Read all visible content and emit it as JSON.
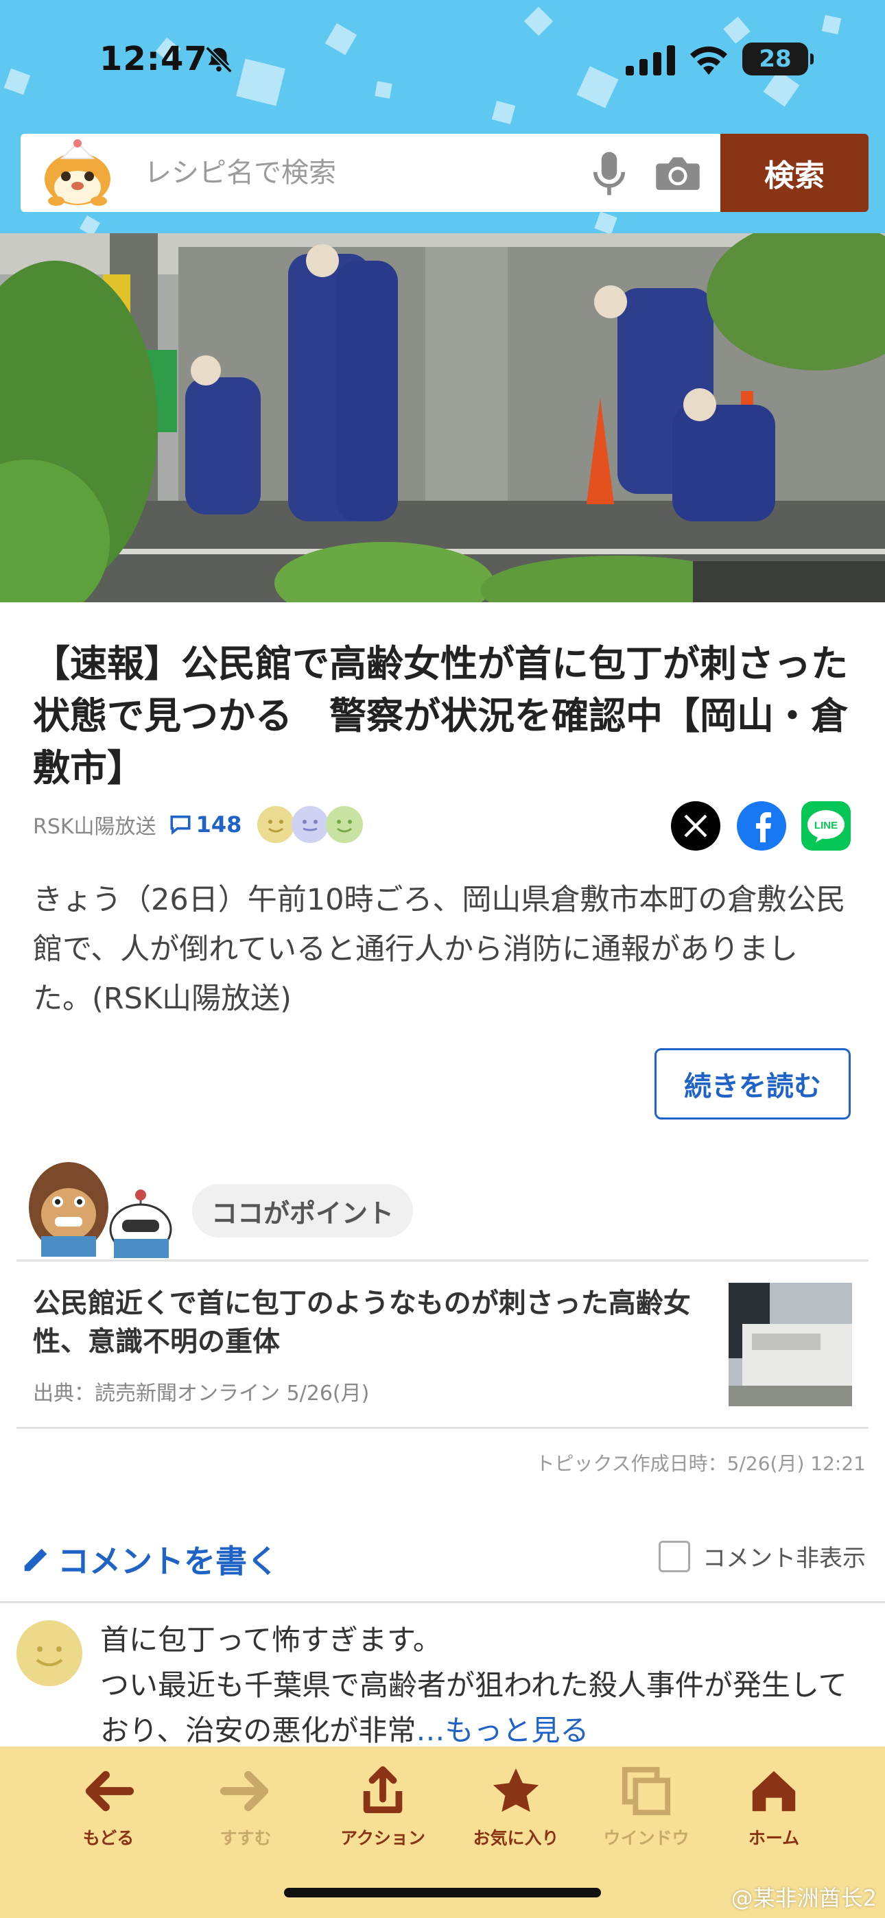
{
  "status_bar": {
    "time": "12:47",
    "battery": "28"
  },
  "search": {
    "placeholder": "レシピ名で検索",
    "button": "検索"
  },
  "article": {
    "headline": "【速報】公民館で高齢女性が首に包丁が刺さった状態で見つかる　警察が状況を確認中【岡山・倉敷市】",
    "source": "RSK山陽放送",
    "comment_count": "148",
    "lead": "きょう（26日）午前10時ごろ、岡山県倉敷市本町の倉敷公民館で、人が倒れていると通行人から消防に通報がありました。(RSK山陽放送)",
    "read_more": "続きを読む",
    "share_x": "X",
    "share_line": "LINE"
  },
  "point": {
    "label": "ココがポイント",
    "related_title": "公民館近くで首に包丁のようなものが刺さった高齢女性、意識不明の重体",
    "related_source": "出典：読売新聞オンライン 5/26(月)",
    "topics_time": "トピックス作成日時：5/26(月) 12:21"
  },
  "comments": {
    "write": "コメントを書く",
    "hide": "コメント非表示",
    "first_text": "首に包丁って怖すぎます。\nつい最近も千葉県で高齢者が狙われた殺人事件が発生しており、治安の悪化が非常",
    "more": "…もっと見る"
  },
  "toolbar": {
    "back": "もどる",
    "forward": "すすむ",
    "action": "アクション",
    "favorite": "お気に入り",
    "window": "ウインドウ",
    "home": "ホーム"
  },
  "colors": {
    "header_bg": "#5ec8f0",
    "search_button": "#8a3415",
    "link_blue": "#1f63c6",
    "toolbar_bg": "#f7e095",
    "toolbar_active": "#8a3415",
    "toolbar_disabled": "#c9a96a"
  },
  "icons": [
    "bell-slash-icon",
    "signal-icon",
    "wifi-icon",
    "battery-icon",
    "mic-icon",
    "camera-icon",
    "comment-icon",
    "x-icon",
    "facebook-icon",
    "line-icon",
    "pencil-icon",
    "arrow-left-icon",
    "arrow-right-icon",
    "share-icon",
    "star-icon",
    "window-icon",
    "home-icon"
  ],
  "watermark": "@某非洲酋长2"
}
